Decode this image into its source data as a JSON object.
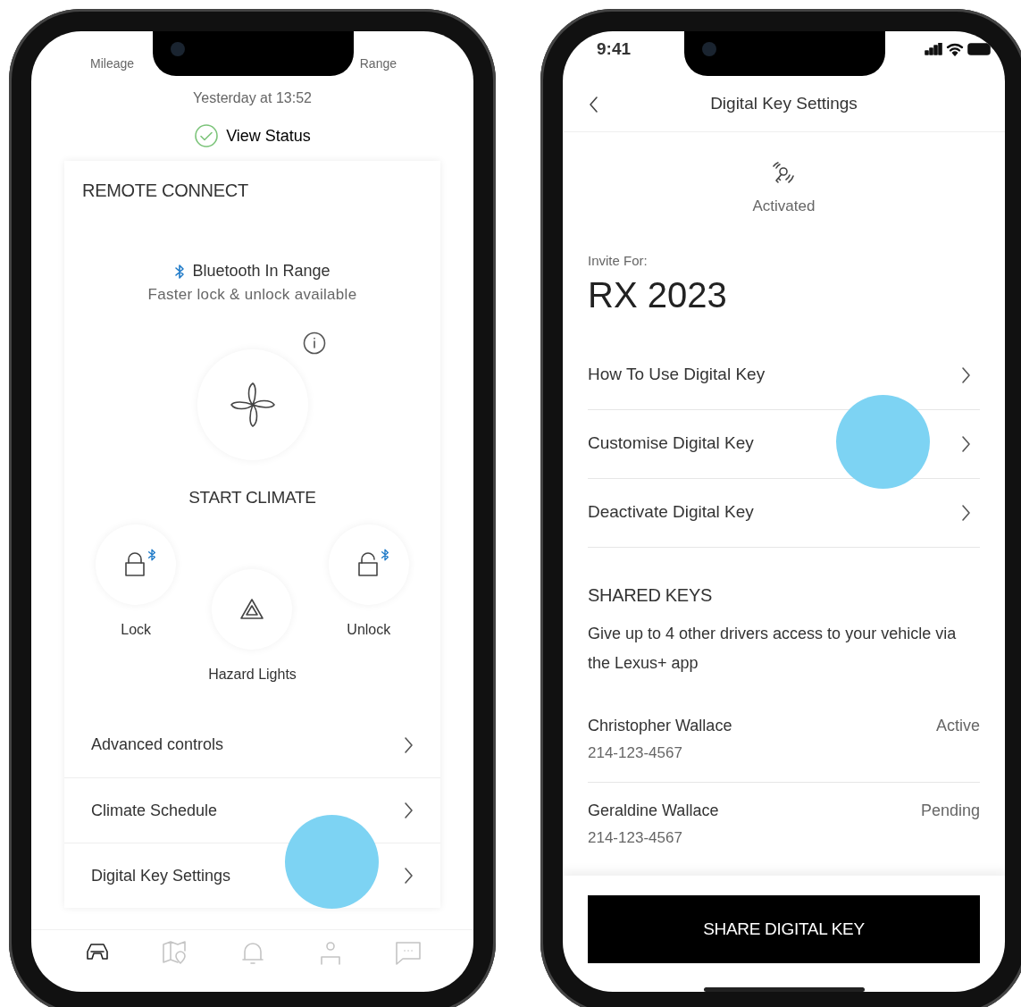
{
  "remote_screen": {
    "stats": [
      {
        "label": "Mileage"
      },
      {
        "label": "Range"
      }
    ],
    "updated": "Yesterday at 13:52",
    "view_status": "View Status",
    "card": {
      "title": "REMOTE CONNECT",
      "bluetooth": {
        "title": "Bluetooth In Range",
        "subtitle": "Faster lock & unlock available"
      },
      "climate": "START CLIMATE",
      "controls": [
        {
          "kind": "lock",
          "label": "Lock",
          "bluetooth": true
        },
        {
          "kind": "hazard",
          "label": "Hazard Lights",
          "bluetooth": false
        },
        {
          "kind": "unlock",
          "label": "Unlock",
          "bluetooth": true
        }
      ],
      "menu": [
        {
          "label": "Advanced controls"
        },
        {
          "label": "Climate Schedule"
        },
        {
          "label": "Digital Key Settings"
        }
      ]
    },
    "tab_bar": [
      {
        "kind": "car",
        "selected": true
      },
      {
        "kind": "map",
        "selected": false
      },
      {
        "kind": "bell",
        "selected": false
      },
      {
        "kind": "person",
        "selected": false
      },
      {
        "kind": "chat",
        "selected": false
      }
    ]
  },
  "digital_key_screen": {
    "status_bar": {
      "time": "9:41"
    },
    "title": "Digital Key Settings",
    "key_status": "Activated",
    "invite_label": "Invite For:",
    "vehicle": "RX 2023",
    "menu": [
      {
        "label": "How To Use Digital Key"
      },
      {
        "label": "Customise Digital Key"
      },
      {
        "label": "Deactivate Digital Key"
      }
    ],
    "shared_keys": {
      "title": "SHARED KEYS",
      "description": "Give up to 4 other drivers access to your vehicle via the Lexus+ app",
      "people": [
        {
          "name": "Christopher Wallace",
          "phone": "214-123-4567",
          "status": "Active"
        },
        {
          "name": "Geraldine Wallace",
          "phone": "214-123-4567",
          "status": "Pending"
        }
      ]
    },
    "share_button": "SHARE DIGITAL KEY"
  }
}
